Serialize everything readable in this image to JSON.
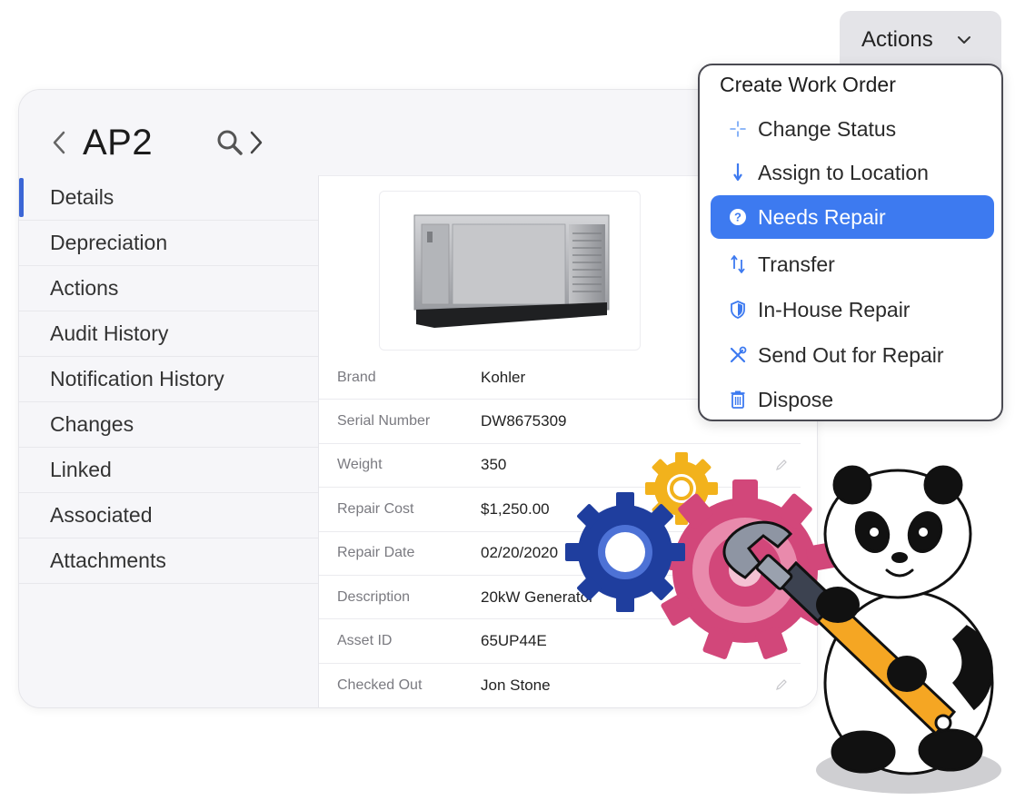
{
  "asset": {
    "title": "AP2"
  },
  "sidebar": {
    "items": [
      {
        "label": "Details",
        "active": true
      },
      {
        "label": "Depreciation"
      },
      {
        "label": "Actions"
      },
      {
        "label": "Audit History"
      },
      {
        "label": "Notification History"
      },
      {
        "label": "Changes"
      },
      {
        "label": "Linked"
      },
      {
        "label": "Associated"
      },
      {
        "label": "Attachments"
      }
    ]
  },
  "details": {
    "fields": [
      {
        "label": "Brand",
        "value": "Kohler"
      },
      {
        "label": "Serial Number",
        "value": "DW8675309"
      },
      {
        "label": "Weight",
        "value": "350"
      },
      {
        "label": "Repair Cost",
        "value": "$1,250.00"
      },
      {
        "label": "Repair Date",
        "value": "02/20/2020"
      },
      {
        "label": "Description",
        "value": "20kW Generator"
      },
      {
        "label": "Asset ID",
        "value": "65UP44E"
      },
      {
        "label": "Checked Out",
        "value": "Jon Stone"
      }
    ]
  },
  "actions": {
    "button_label": "Actions",
    "menu": {
      "header": "Create Work Order",
      "items": [
        {
          "label": "Change Status",
          "icon": "sparkle-icon"
        },
        {
          "label": "Assign to Location",
          "icon": "arrow-down-icon"
        },
        {
          "label": "Needs Repair",
          "icon": "question-circle-icon",
          "selected": true
        },
        {
          "label": "Transfer",
          "icon": "transfer-arrows-icon"
        },
        {
          "label": "In-House Repair",
          "icon": "shield-icon"
        },
        {
          "label": "Send Out for Repair",
          "icon": "tools-icon"
        },
        {
          "label": "Dispose",
          "icon": "trash-icon"
        }
      ]
    }
  },
  "colors": {
    "accent": "#3b66d6",
    "selected_item_bg": "#3d7af0",
    "menu_icon": "#3d7af0"
  }
}
